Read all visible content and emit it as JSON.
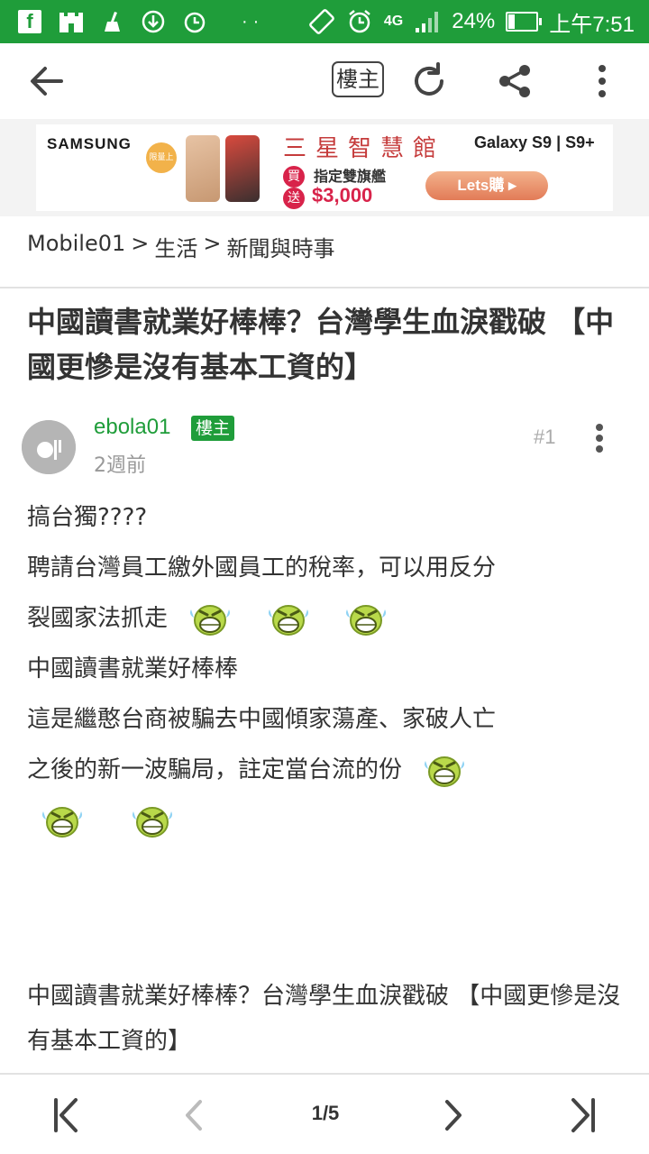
{
  "status_bar": {
    "battery": "24%",
    "battery_level": 0.24,
    "time": "上午7:51",
    "network": "4G",
    "icons": [
      "facebook-icon",
      "castle-icon",
      "cleaner-icon",
      "download-icon",
      "alarm-icon",
      "more-dots-icon",
      "rotate-icon",
      "alarm-icon",
      "signal-icon",
      "battery-icon"
    ]
  },
  "app_bar": {
    "owner_filter_label": "樓主",
    "icons": [
      "back-arrow-icon",
      "refresh-icon",
      "share-icon",
      "more-vert-icon"
    ]
  },
  "ad": {
    "brand": "SAMSUNG",
    "badge": "限量上市",
    "title": "三星智慧館",
    "buy_mark": "買",
    "gift_mark": "送",
    "line1": "指定雙旗艦",
    "line2": "$3,000",
    "model": "Galaxy S9 | S9+",
    "cta": "Lets購 ▸"
  },
  "breadcrumb": {
    "items": [
      "Mobile01",
      "生活",
      "新聞與時事"
    ],
    "separator": ">"
  },
  "post": {
    "title": "中國讀書就業好棒棒？台灣學生血淚戳破 【中國更慘是沒有基本工資的】",
    "author": "ebola01",
    "owner_tag": "樓主",
    "time": "2週前",
    "floor": "#1",
    "body_lines": {
      "l1": "搞台獨????",
      "l2": "聘請台灣員工繳外國員工的稅率，可以用反分",
      "l3": "裂國家法抓走",
      "l4": "中國讀書就業好棒棒",
      "l5": "這是繼憨台商被騙去中國傾家蕩產、家破人亡",
      "l6": "之後的新一波騙局，註定當台流的份"
    },
    "emoji_name": "laughing-tears-emoji",
    "footer_text": "中國讀書就業好棒棒？台灣學生血淚戳破 【中國更慘是沒有基本工資的】"
  },
  "pagination": {
    "current": "1/5",
    "icons": [
      "first-page-icon",
      "prev-page-icon",
      "next-page-icon",
      "last-page-icon"
    ]
  },
  "colors": {
    "brand_green": "#1f9d3a",
    "text": "#333333",
    "muted": "#999999"
  }
}
